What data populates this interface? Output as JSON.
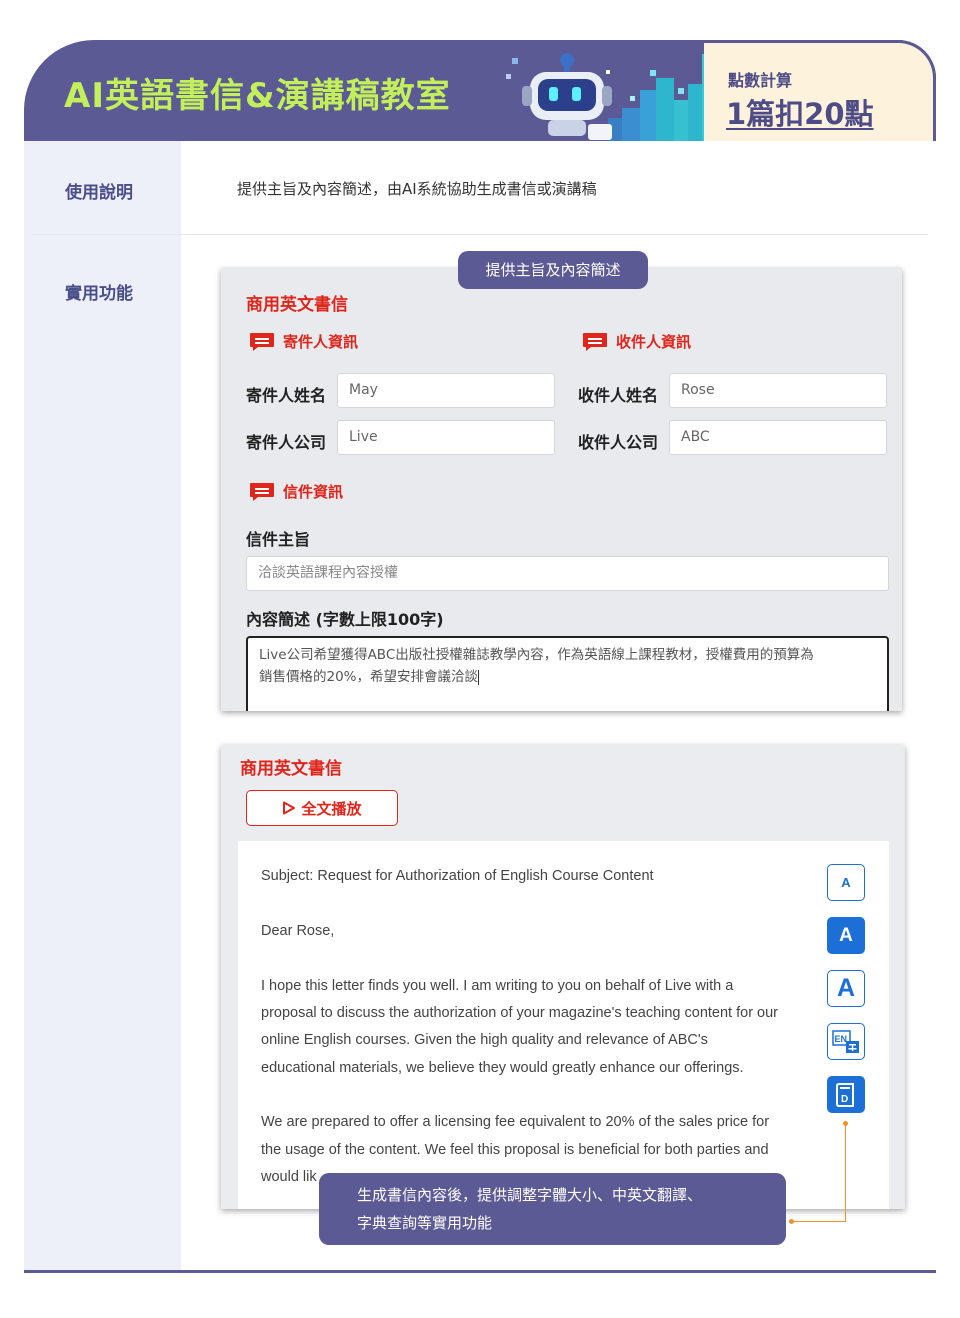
{
  "header": {
    "title": "AI英語書信&演講稿教室",
    "points_label": "點數計算",
    "points_value": "1篇扣20點"
  },
  "rows": {
    "usage_label": "使用說明",
    "usage_text": "提供主旨及內容簡述，由AI系統協助生成書信或演講稿",
    "features_label": "實用功能"
  },
  "form": {
    "callout": "提供主旨及內容簡述",
    "title": "商用英文書信",
    "sender_section": "寄件人資訊",
    "recipient_section": "收件人資訊",
    "sender_name_label": "寄件人姓名",
    "sender_name_value": "May",
    "sender_company_label": "寄件人公司",
    "sender_company_value": "Live",
    "recipient_name_label": "收件人姓名",
    "recipient_name_value": "Rose",
    "recipient_company_label": "收件人公司",
    "recipient_company_value": "ABC",
    "letter_section": "信件資訊",
    "subject_label": "信件主旨",
    "subject_placeholder": "洽談英語課程內容授權",
    "content_label": "內容簡述 (字數上限100字)",
    "content_line1": "Live公司希望獲得ABC出版社授權雜誌教學內容，作為英語線上課程教材，授權費用的預算為",
    "content_line2": "銷售價格的20%，希望安排會議洽談"
  },
  "letter": {
    "title": "商用英文書信",
    "play_label": "全文播放",
    "lines": [
      "Subject: Request for Authorization of English Course Content",
      "Dear Rose,",
      "I hope this letter finds you well. I am writing to you on behalf of Live with a",
      "proposal to discuss the authorization of your magazine's teaching content for our",
      "online English courses. Given the high quality and relevance of ABC's",
      "educational materials, we believe they would greatly enhance our offerings.",
      "We are prepared to offer a licensing fee equivalent to 20% of the sales price for",
      "the usage of the content. We feel this proposal is beneficial for both parties and",
      "would lik"
    ],
    "tools": {
      "font_small": "A",
      "font_medium": "A",
      "font_large": "A",
      "translate_icon": "en-zh-translate-icon",
      "dictionary_icon": "dictionary-icon"
    },
    "callout_line1": "生成書信內容後，提供調整字體大小、中英文翻譯、",
    "callout_line2": "字典查詢等實用功能"
  },
  "colors": {
    "brand_purple": "#5b5a94",
    "title_green": "#c3f05a",
    "accent_red": "#e0251b",
    "tool_blue": "#1c6fd6",
    "connector_orange": "#f0922b"
  }
}
